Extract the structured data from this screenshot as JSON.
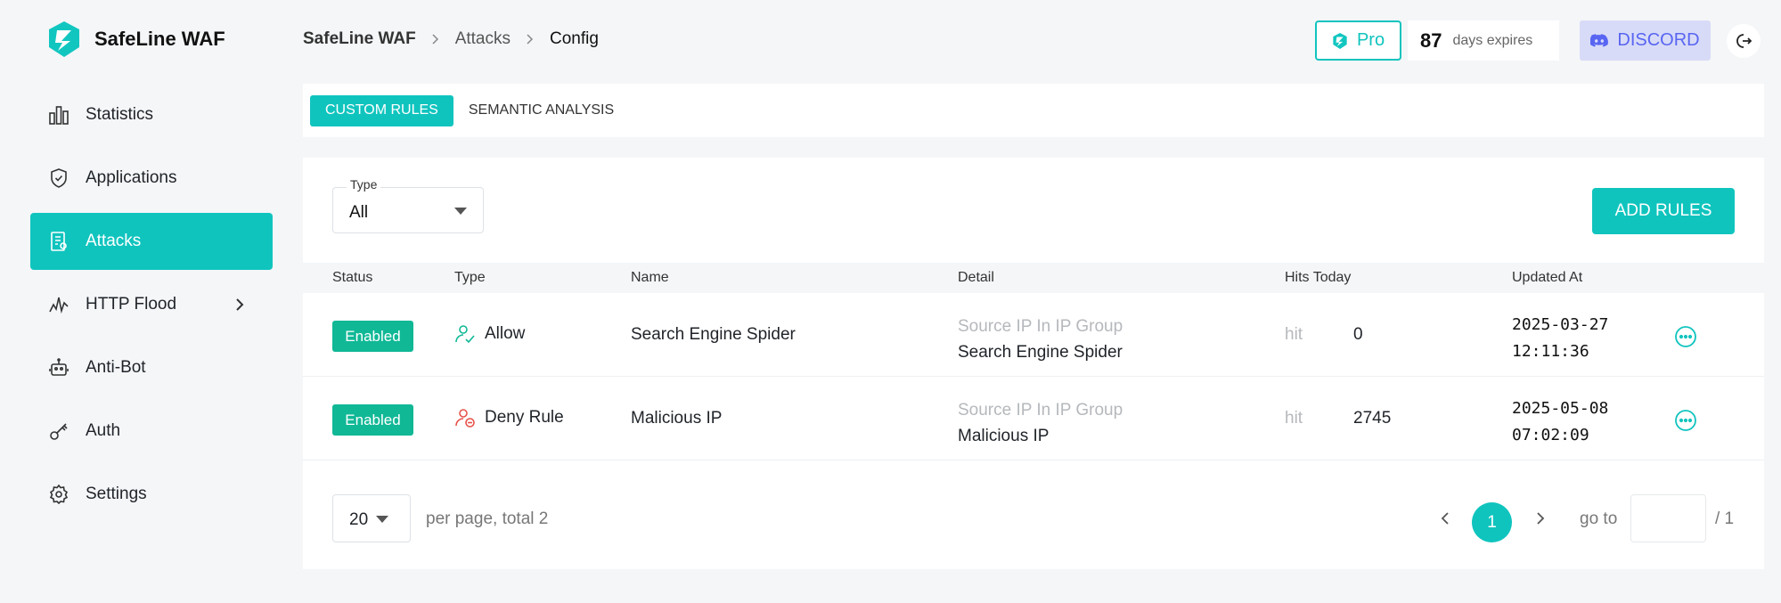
{
  "brand": {
    "name": "SafeLine WAF"
  },
  "sidebar": {
    "items": [
      {
        "label": "Statistics",
        "icon": "bar-chart-icon"
      },
      {
        "label": "Applications",
        "icon": "shield-icon"
      },
      {
        "label": "Attacks",
        "icon": "report-icon",
        "active": true
      },
      {
        "label": "HTTP Flood",
        "icon": "pulse-icon"
      },
      {
        "label": "Anti-Bot",
        "icon": "robot-icon"
      },
      {
        "label": "Auth",
        "icon": "key-icon"
      },
      {
        "label": "Settings",
        "icon": "gear-icon"
      }
    ]
  },
  "header": {
    "breadcrumb": [
      "SafeLine WAF",
      "Attacks",
      "Config"
    ],
    "pro_label": "Pro",
    "expire_days": "87",
    "expire_text": "days expires",
    "discord_label": "DISCORD"
  },
  "tabs": [
    "CUSTOM RULES",
    "SEMANTIC ANALYSIS"
  ],
  "filter": {
    "label": "Type",
    "value": "All"
  },
  "add_button": "ADD RULES",
  "table": {
    "headers": [
      "Status",
      "Type",
      "Name",
      "Detail",
      "Hits Today",
      "Updated At"
    ],
    "rows": [
      {
        "status": "Enabled",
        "type": "Allow",
        "name": "Search Engine Spider",
        "detail_key": "Source IP In IP Group",
        "detail_value": "Search Engine Spider",
        "hit_label": "hit",
        "hits": "0",
        "updated_date": "2025-03-27",
        "updated_time": "12:11:36"
      },
      {
        "status": "Enabled",
        "type": "Deny Rule",
        "name": "Malicious IP",
        "detail_key": "Source IP In IP Group",
        "detail_value": "Malicious IP",
        "hit_label": "hit",
        "hits": "2745",
        "updated_date": "2025-05-08",
        "updated_time": "07:02:09"
      }
    ]
  },
  "pagination": {
    "per_page": "20",
    "per_page_text": "per page, total 2",
    "current_page": "1",
    "goto_text": "go to",
    "total_pages": "/ 1"
  },
  "colors": {
    "accent": "#10c4be",
    "enabled": "#10b896",
    "discord": "#5865f2",
    "deny": "#e5534b"
  }
}
